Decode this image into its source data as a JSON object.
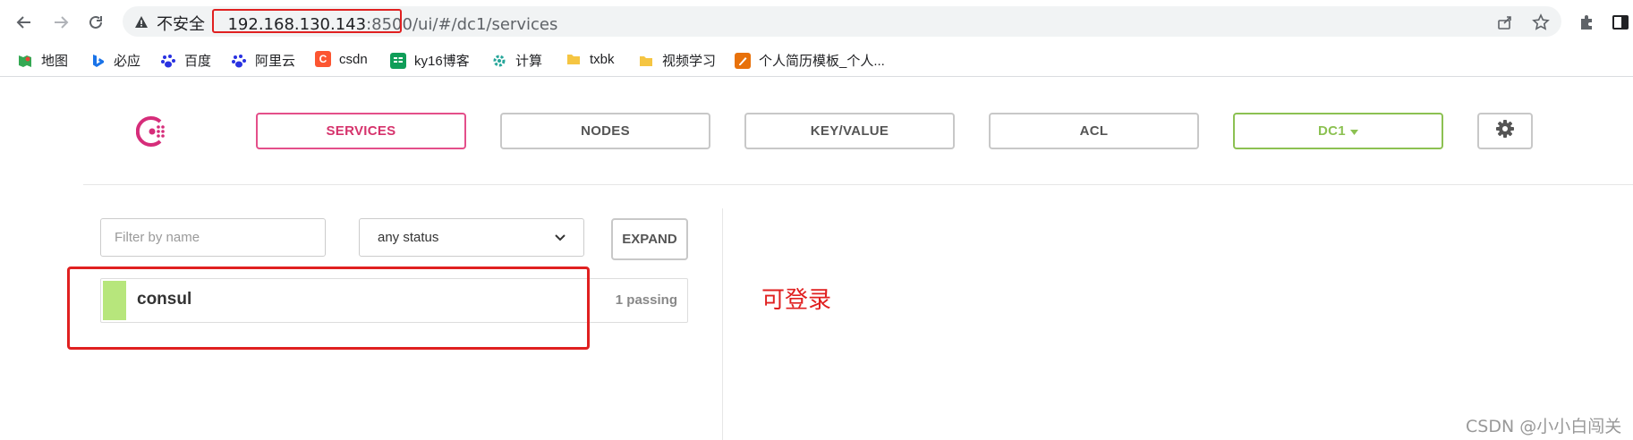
{
  "browser": {
    "security_label": "不安全",
    "url_host": "192.168.130.143",
    "url_port": ":8500",
    "url_path": "/ui/#/dc1/services"
  },
  "bookmarks": [
    {
      "label": "地图",
      "icon": "maps-icon",
      "color": "#34a853"
    },
    {
      "label": "必应",
      "icon": "bing-icon",
      "color": "#1a73e8"
    },
    {
      "label": "百度",
      "icon": "baidu-icon",
      "color": "#2932e1"
    },
    {
      "label": "阿里云",
      "icon": "baidu-icon",
      "color": "#2932e1"
    },
    {
      "label": "csdn",
      "icon": "csdn-icon",
      "color": "#fc5531"
    },
    {
      "label": "ky16博客",
      "icon": "sheet-icon",
      "color": "#0f9d58"
    },
    {
      "label": "计算",
      "icon": "gear-icon",
      "color": "#26a69a"
    },
    {
      "label": "txbk",
      "icon": "folder-icon",
      "color": "#f5c542"
    },
    {
      "label": "视频学习",
      "icon": "folder-icon",
      "color": "#f5c542"
    },
    {
      "label": "个人简历模板_个人...",
      "icon": "resume-icon",
      "color": "#e8710a"
    }
  ],
  "nav": {
    "services": "SERVICES",
    "nodes": "NODES",
    "key_value": "KEY/VALUE",
    "acl": "ACL",
    "datacenter": "DC1"
  },
  "filter": {
    "placeholder": "Filter by name",
    "status": "any status",
    "expand": "EXPAND"
  },
  "services": [
    {
      "name": "consul",
      "status": "1 passing",
      "health_color": "#b7e67c"
    }
  ],
  "annotation": "可登录",
  "watermark": "CSDN @小小白闯关",
  "colors": {
    "accent": "#d6336c",
    "dc_green": "#8cc152",
    "highlight_red": "#e02020"
  }
}
